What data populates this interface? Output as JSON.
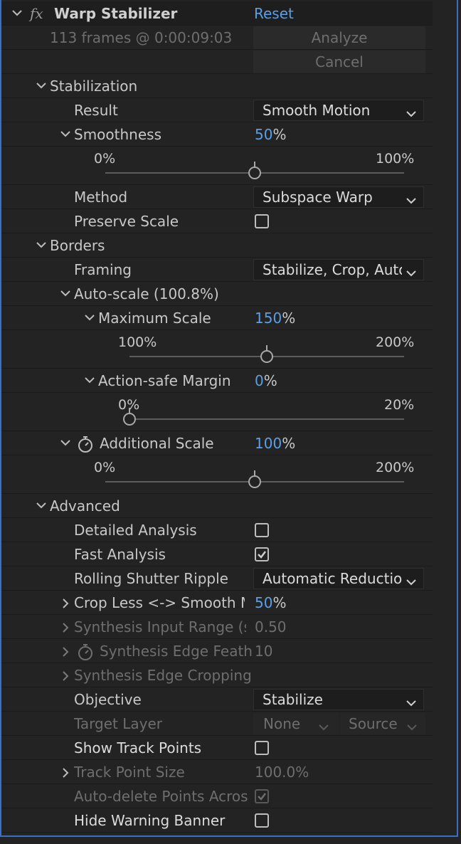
{
  "header": {
    "fx_label": "fx",
    "title": "Warp Stabilizer",
    "reset_label": "Reset"
  },
  "analysis": {
    "frames_info": "113 frames @ 0:00:09:03",
    "analyze_label": "Analyze",
    "cancel_label": "Cancel"
  },
  "stabilization": {
    "section_label": "Stabilization",
    "result": {
      "label": "Result",
      "value": "Smooth Motion"
    },
    "smoothness": {
      "label": "Smoothness",
      "value": "50",
      "unit": "%",
      "min": "0%",
      "max": "100%",
      "fraction": 0.5
    },
    "method": {
      "label": "Method",
      "value": "Subspace Warp"
    },
    "preserve_scale": {
      "label": "Preserve Scale",
      "checked": false
    }
  },
  "borders": {
    "section_label": "Borders",
    "framing": {
      "label": "Framing",
      "value": "Stabilize, Crop, Auto"
    },
    "auto_scale": {
      "label": "Auto-scale (100.8%)"
    },
    "maximum_scale": {
      "label": "Maximum Scale",
      "value": "150",
      "unit": "%",
      "min": "100%",
      "max": "200%",
      "fraction": 0.5
    },
    "action_safe_margin": {
      "label": "Action-safe Margin",
      "value": "0",
      "unit": "%",
      "min": "0%",
      "max": "20%",
      "fraction": 0.0
    },
    "additional_scale": {
      "label": "Additional Scale",
      "value": "100",
      "unit": "%",
      "min": "0%",
      "max": "200%",
      "fraction": 0.5
    }
  },
  "advanced": {
    "section_label": "Advanced",
    "detailed_analysis": {
      "label": "Detailed Analysis",
      "checked": false
    },
    "fast_analysis": {
      "label": "Fast Analysis",
      "checked": true
    },
    "rolling_shutter_ripple": {
      "label": "Rolling Shutter Ripple",
      "value": "Automatic Reductio"
    },
    "crop_less": {
      "label": "Crop Less <-> Smooth M",
      "value": "50",
      "unit": "%"
    },
    "synthesis_input_range": {
      "label": "Synthesis Input Range (s",
      "value": "0.50"
    },
    "synthesis_edge_feather": {
      "label": "Synthesis Edge Feath",
      "value": "10"
    },
    "synthesis_edge_cropping": {
      "label": "Synthesis Edge Cropping"
    },
    "objective": {
      "label": "Objective",
      "value": "Stabilize"
    },
    "target_layer": {
      "label": "Target Layer",
      "layer_value": "None",
      "source_value": "Source"
    },
    "show_track_points": {
      "label": "Show Track Points",
      "checked": false
    },
    "track_point_size": {
      "label": "Track Point Size",
      "value": "100.0%"
    },
    "auto_delete_points": {
      "label": "Auto-delete Points Acros",
      "checked": true
    },
    "hide_warning_banner": {
      "label": "Hide Warning Banner",
      "checked": false
    }
  },
  "colors": {
    "accent_blue": "#5a9fe8",
    "panel_border": "#3a6fc4",
    "background": "#232323"
  }
}
